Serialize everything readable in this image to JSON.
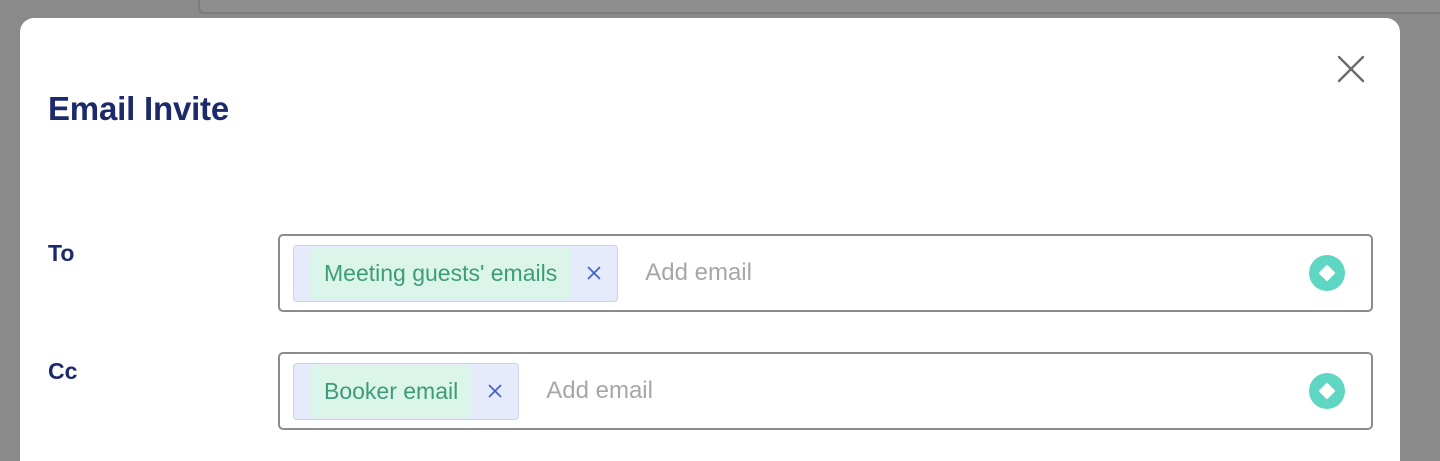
{
  "modal": {
    "title": "Email Invite",
    "close_icon": "close-icon"
  },
  "fields": {
    "to": {
      "label": "To",
      "chips": [
        {
          "label": "Meeting guests' emails",
          "remove_icon": "close-icon"
        }
      ],
      "placeholder": "Add email",
      "action_icon": "diamond-circle-icon"
    },
    "cc": {
      "label": "Cc",
      "chips": [
        {
          "label": "Booker email",
          "remove_icon": "close-icon"
        }
      ],
      "placeholder": "Add email",
      "action_icon": "diamond-circle-icon"
    }
  },
  "colors": {
    "title": "#1c2a6b",
    "chip_background": "#e6ebfb",
    "chip_text": "#3d9c78",
    "chip_highlight": "#dcf5ea",
    "action_icon": "#5fd6c2",
    "backdrop": "#8a8a8a"
  }
}
